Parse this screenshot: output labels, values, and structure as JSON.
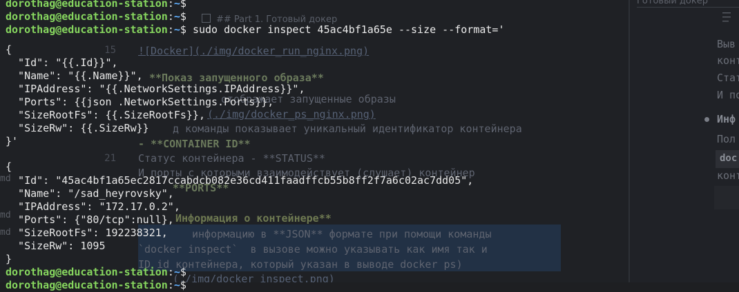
{
  "editor": {
    "tab_title": "## Part 1. Готовый докер",
    "line_numbers": [
      "15",
      "21"
    ],
    "lines": [
      "![Docker](./img/docker_run_nginx.png)",
      "**Показ запущенного образа**",
      "отображает запущенные образы",
      "(./img/docker_ps_nginx.png)",
      "д команды показывает уникальный идентификатор контейнера",
      "- **CONTAINER ID**",
      "Статус контейнера - **STATUS**",
      "И порты с которыми взаимодействует (слушает) контейнер",
      "**PORTS**",
      "Информация о контейнере**",
      "информацию в **JSON** формате при помощи команды",
      "`docker inspect`  в вызове можно указывать как имя так и",
      "ID id контейнера, который указан в выводе docker ps)",
      "(./img/docker_inspect.png)"
    ],
    "left_files": [
      "md",
      "md",
      "md"
    ]
  },
  "preview": {
    "header": "Готовый докер",
    "lines": [
      "Выв",
      "конт",
      "Стат",
      "И по"
    ],
    "bullet_heading": "Инф",
    "line_after_bullet": "Пол",
    "code_snippet": "doc",
    "line_after_code": "конт"
  },
  "terminal": {
    "user_host": "dorothag@education-station",
    "path": "~",
    "symbol": "$",
    "command": "sudo docker inspect 45ac4bf1a65e --size --format='",
    "template_lines": [
      "{",
      "  \"Id\": \"{{.Id}}\",",
      "  \"Name\": \"{{.Name}}\",",
      "  \"IPAddress\": \"{{.NetworkSettings.IPAddress}}\",",
      "  \"Ports\": {{json .NetworkSettings.Ports}},",
      "  \"SizeRootFs\": {{.SizeRootFs}},",
      "  \"SizeRw\": {{.SizeRw}}",
      "}'"
    ],
    "output_lines": [
      "{",
      "  \"Id\": \"45ac4bf1a65ec2817ccabdcb082e36cd411faadffcb55b8ff2f7a6c02ac7dd05\",",
      "  \"Name\": \"/sad_heyrovsky\",",
      "  \"IPAddress\": \"172.17.0.2\",",
      "  \"Ports\": {\"80/tcp\":null},",
      "  \"SizeRootFs\": 192238321,",
      "  \"SizeRw\": 1095",
      "}"
    ]
  },
  "colors": {
    "prompt_user": "#87d75f",
    "prompt_path": "#5fafff",
    "terminal_text": "#e8e8e8"
  }
}
